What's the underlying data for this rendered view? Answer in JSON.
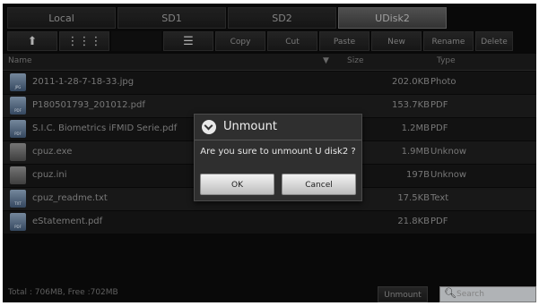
{
  "tabs": [
    "Local",
    "SD1",
    "SD2",
    "UDisk2"
  ],
  "active_tab": "UDisk2",
  "toolbar": {
    "up_icon": "up-arrow-icon",
    "grid_icon": "grid-view-icon",
    "list_icon": "list-select-icon",
    "buttons": [
      "Copy",
      "Cut",
      "Paste",
      "New",
      "Rename",
      "Delete"
    ]
  },
  "columns": {
    "name": "Name",
    "size": "Size",
    "type": "Type",
    "sort_indicator": "▼"
  },
  "files": [
    {
      "name": "2011-1-28-7-18-33.jpg",
      "size": "202.0KB",
      "type": "Photo",
      "icon": "image-file-icon",
      "tag": "JPG"
    },
    {
      "name": "P180501793_201012.pdf",
      "size": "153.7KB",
      "type": "PDF",
      "icon": "pdf-file-icon",
      "tag": "PDF"
    },
    {
      "name": "S.I.C. Biometrics iFMID Serie.pdf",
      "size": "1.2MB",
      "type": "PDF",
      "icon": "pdf-file-icon",
      "tag": "PDF"
    },
    {
      "name": "cpuz.exe",
      "size": "1.9MB",
      "type": "Unknow",
      "icon": "unknown-file-icon",
      "tag": ""
    },
    {
      "name": "cpuz.ini",
      "size": "197B",
      "type": "Unknow",
      "icon": "unknown-file-icon",
      "tag": ""
    },
    {
      "name": "cpuz_readme.txt",
      "size": "17.5KB",
      "type": "Text",
      "icon": "text-file-icon",
      "tag": "TXT"
    },
    {
      "name": "eStatement.pdf",
      "size": "21.8KB",
      "type": "PDF",
      "icon": "pdf-file-icon",
      "tag": "PDF"
    }
  ],
  "footer": {
    "total": "Total : 706MB, Free :702MB",
    "unmount_label": "Unmount",
    "search_placeholder": "Search",
    "search_icon": "search-icon"
  },
  "dialog": {
    "title": "Unmount",
    "message": "Are you sure to unmount U disk2 ?",
    "ok_label": "OK",
    "cancel_label": "Cancel",
    "icon": "info-circle-icon"
  }
}
